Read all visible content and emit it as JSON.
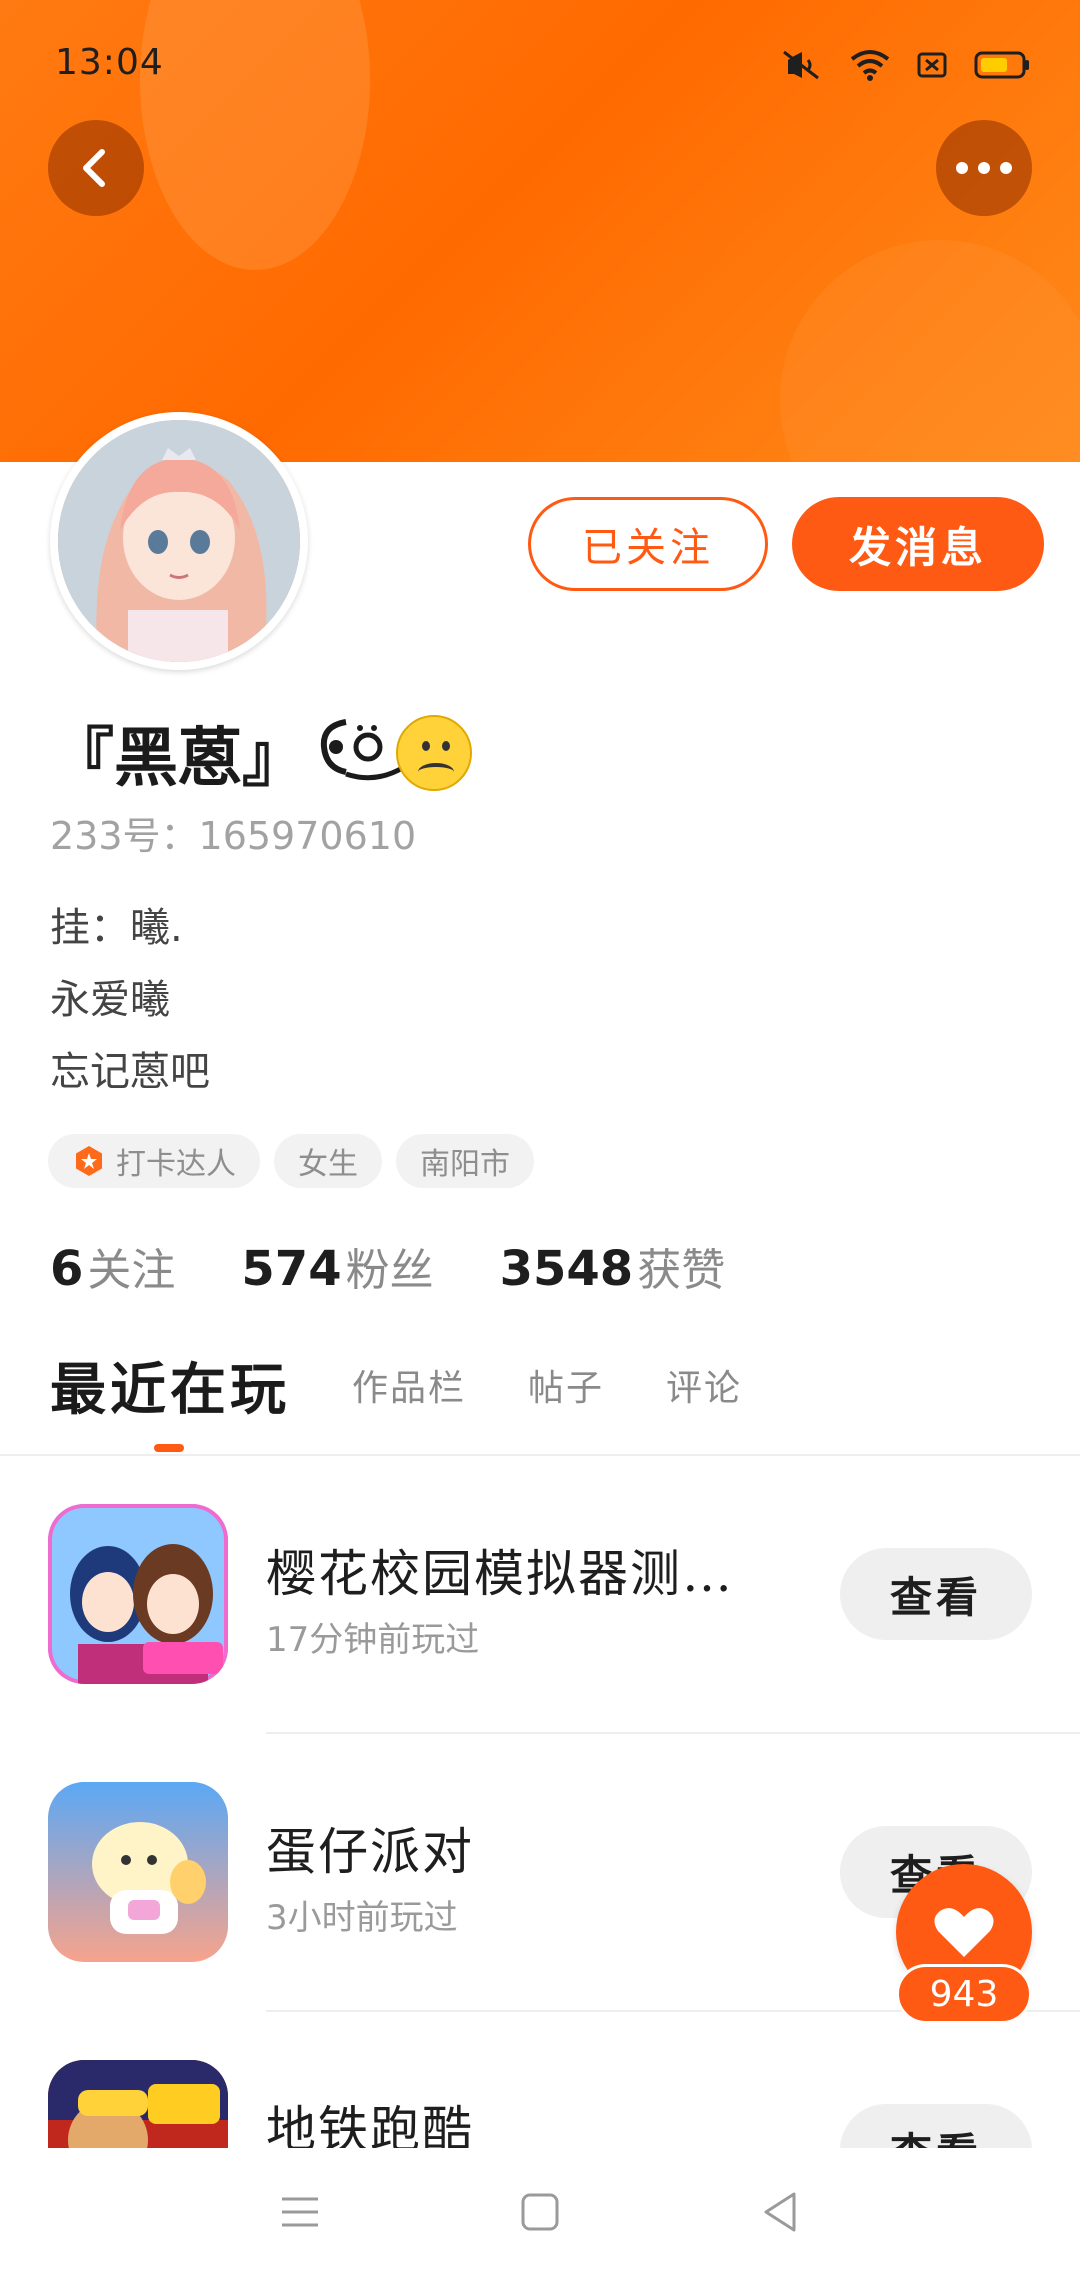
{
  "status_bar": {
    "time": "13:04"
  },
  "header": {
    "back_icon": "chevron-left-icon",
    "more_icon": "more-horizontal-icon"
  },
  "profile": {
    "follow_label": "已关注",
    "message_label": "发消息",
    "name": "『黑蒽』",
    "kaomoji": "ò̈",
    "user_id": "233号：165970610",
    "bio": [
      "挂：曦.",
      "永爱曦",
      "忘记蒽吧"
    ],
    "tags": [
      {
        "label": "打卡达人",
        "icon": "checkin-badge-icon"
      },
      {
        "label": "女生"
      },
      {
        "label": "南阳市"
      }
    ],
    "stats": [
      {
        "num": "6",
        "label": "关注"
      },
      {
        "num": "574",
        "label": "粉丝"
      },
      {
        "num": "3548",
        "label": "获赞"
      }
    ]
  },
  "tabs": [
    {
      "label": "最近在玩",
      "active": true
    },
    {
      "label": "作品栏"
    },
    {
      "label": "帖子"
    },
    {
      "label": "评论"
    }
  ],
  "games": [
    {
      "title": "樱花校园模拟器测…",
      "sub": "17分钟前玩过",
      "button": "查看"
    },
    {
      "title": "蛋仔派对",
      "sub": "3小时前玩过",
      "button": "查看"
    },
    {
      "title": "地铁跑酷",
      "sub": "",
      "button": "查看"
    }
  ],
  "like": {
    "count": "943"
  },
  "colors": {
    "accent": "#ff5a14",
    "banner": "#ff7a12"
  }
}
